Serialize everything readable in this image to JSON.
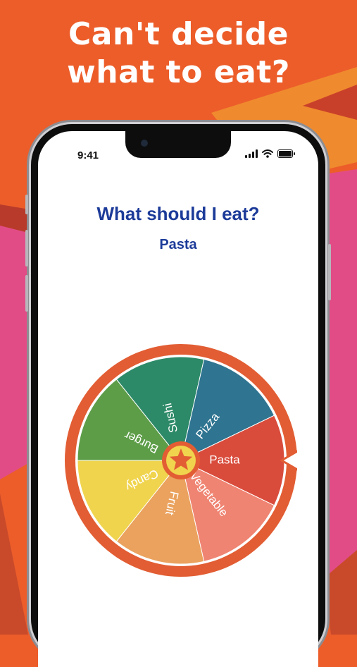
{
  "headline": {
    "line1": "Can't decide",
    "line2": "what to eat?"
  },
  "status_bar": {
    "time": "9:41"
  },
  "app": {
    "title": "What should I eat?",
    "result": "Pasta",
    "wheel": {
      "segments": [
        {
          "label": "Sushi",
          "color": "#2d8a68"
        },
        {
          "label": "Pizza",
          "color": "#2f7490"
        },
        {
          "label": "Pasta",
          "color": "#d94c3c"
        },
        {
          "label": "Vegetable",
          "color": "#ef8472"
        },
        {
          "label": "Fruit",
          "color": "#eaa25e"
        },
        {
          "label": "Candy",
          "color": "#f0d44e"
        },
        {
          "label": "Burger",
          "color": "#5d9d48"
        }
      ],
      "rim_color": "#e25d33",
      "center_icon": "star-icon",
      "center_color": "#f0d44e"
    }
  },
  "colors": {
    "background": "#ec5d2a",
    "accent_pink": "#e24c86",
    "title_blue": "#1c3b99"
  }
}
